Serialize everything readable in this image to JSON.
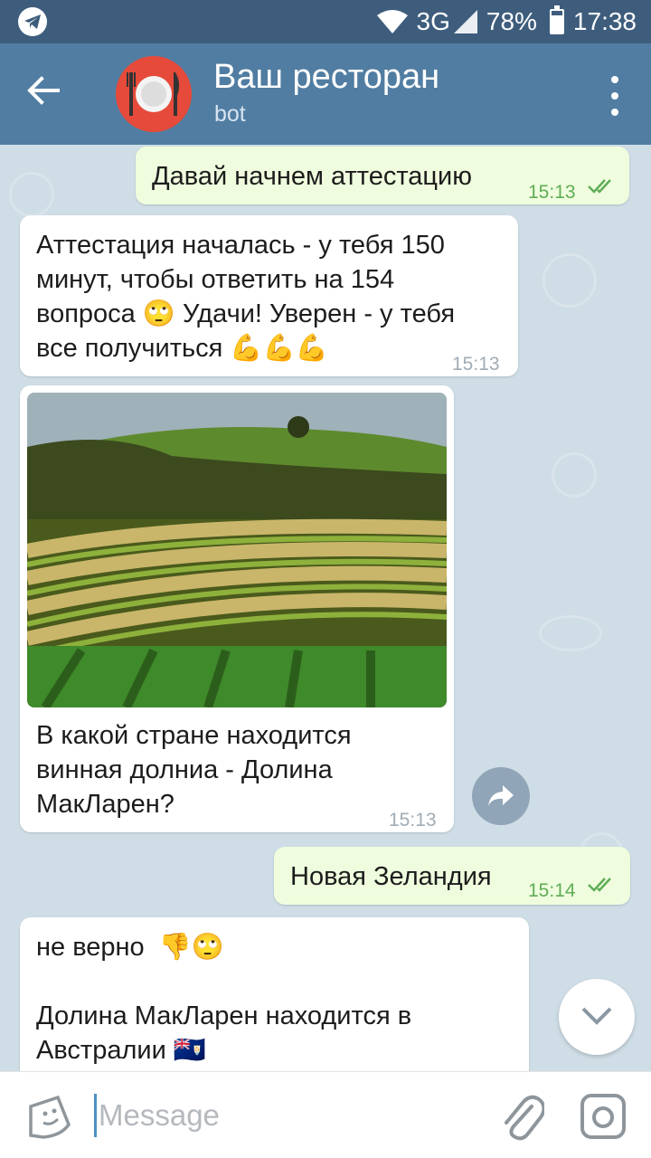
{
  "status_bar": {
    "network": "3G",
    "battery_text": "78%",
    "battery_level": 0.78,
    "time": "17:38",
    "icons": [
      "telegram-icon",
      "wifi-icon",
      "signal-icon",
      "battery-icon"
    ]
  },
  "header": {
    "title": "Ваш ресторан",
    "subtitle": "bot",
    "icons": [
      "back-arrow-icon",
      "restaurant-avatar",
      "more-vertical-icon"
    ]
  },
  "messages": [
    {
      "direction": "out",
      "text": "Давай начнем аттестацию",
      "time": "15:13",
      "read": true
    },
    {
      "direction": "in",
      "lines": [
        "Аттестация началась - у тебя 150",
        "минут, чтобы ответить на 154",
        "вопроса 🙄 Удачи! Уверен - у тебя",
        "все получиться 💪💪💪"
      ],
      "time": "15:13"
    },
    {
      "direction": "in",
      "has_photo": true,
      "lines": [
        "В какой стране находится",
        "винная долниа - Долина",
        "МакЛарен?"
      ],
      "time": "15:13"
    },
    {
      "direction": "out",
      "text": "Новая Зеландия",
      "time": "15:14",
      "read": true
    },
    {
      "direction": "in",
      "lines": [
        "не верно  👎🙄",
        "",
        "Долина МакЛарен находится в",
        "Австралии 🇦🇮"
      ]
    }
  ],
  "input": {
    "placeholder": "Message",
    "value": ""
  },
  "colors": {
    "status_bar": "#3e5d7d",
    "header": "#517da2",
    "chat_bg": "#cfdde6",
    "outgoing_bubble": "#effdde",
    "incoming_bubble": "#ffffff",
    "time_out": "#5fad56",
    "avatar": "#e64a3a"
  }
}
